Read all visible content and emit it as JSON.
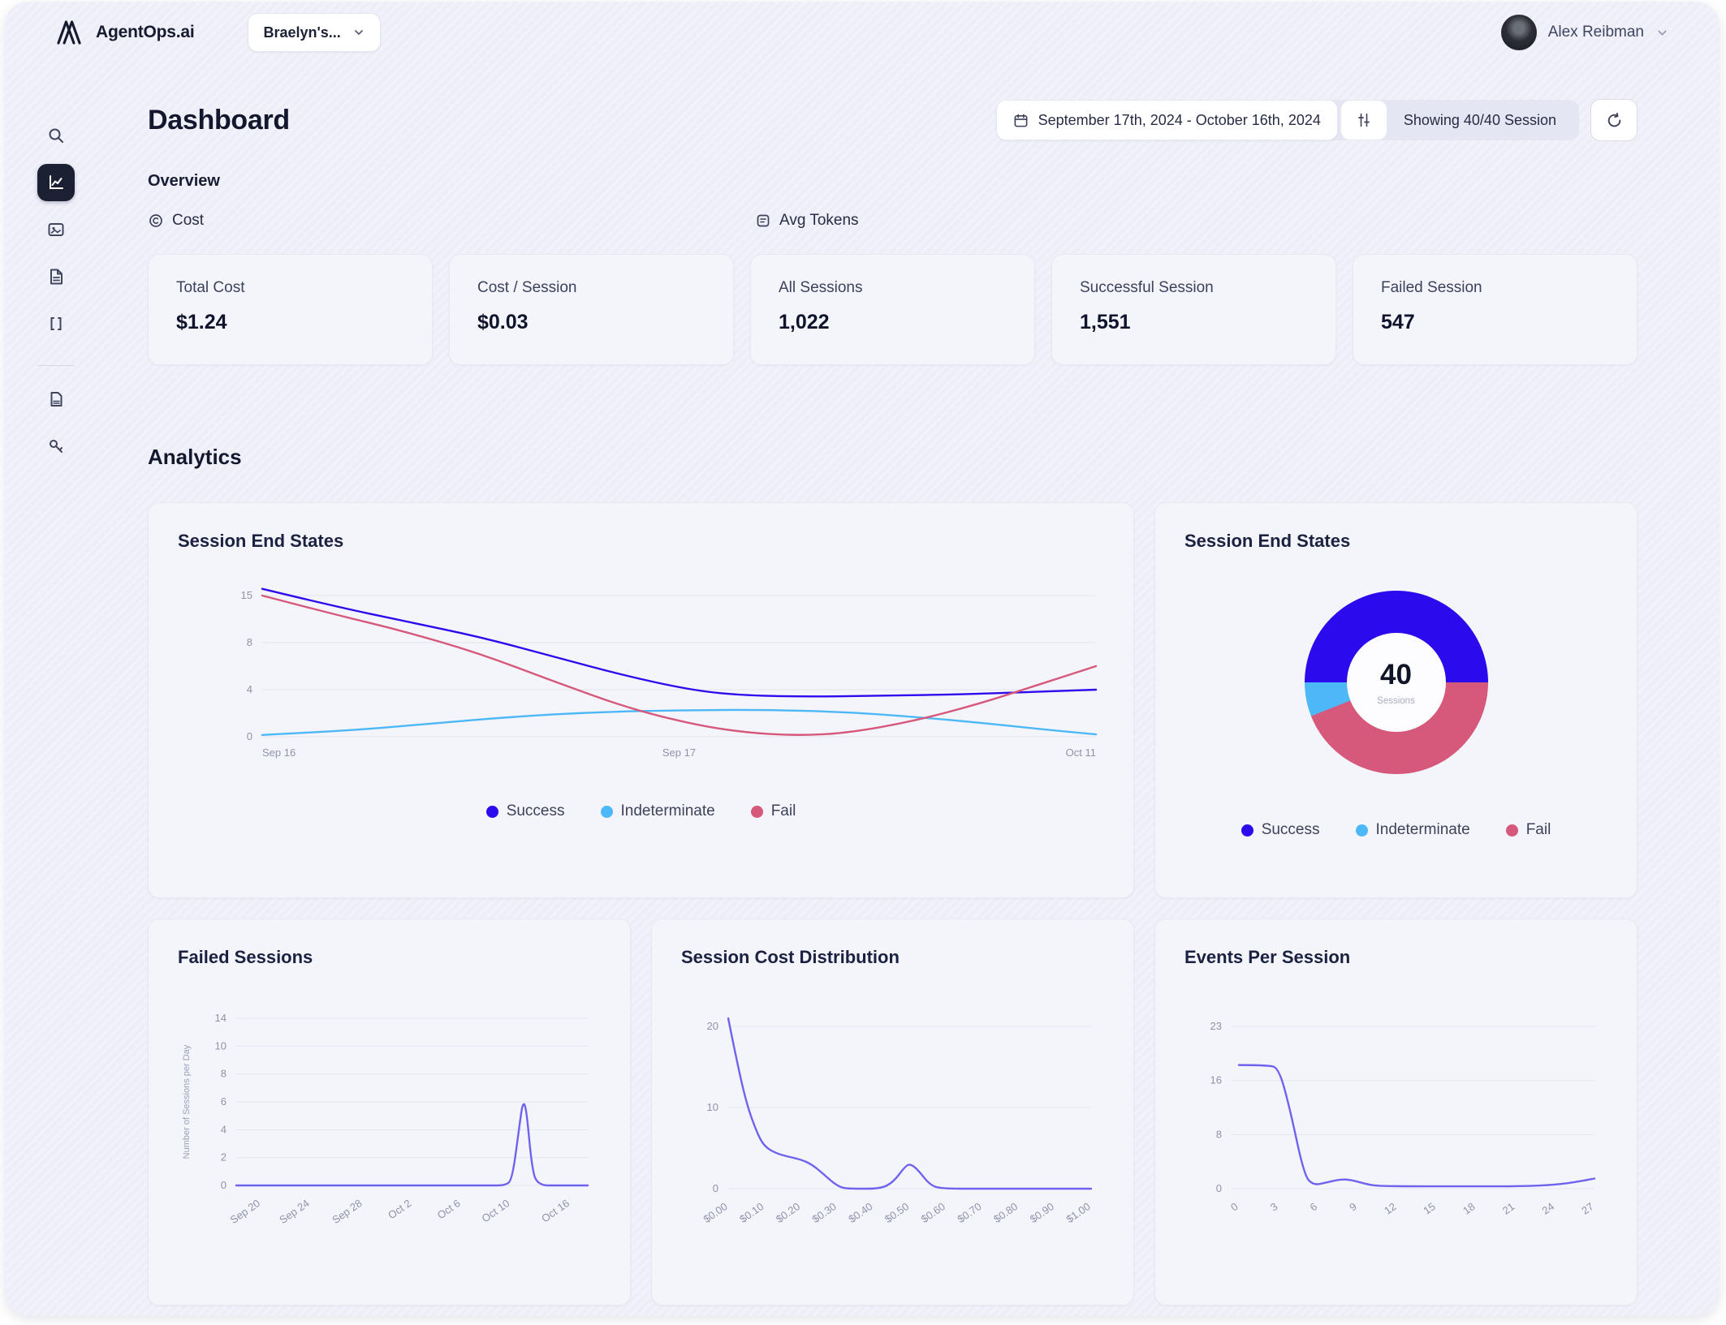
{
  "topbar": {
    "brand": "AgentOps.ai",
    "project_selector": "Braelyn's...",
    "user_name": "Alex Reibman"
  },
  "sidebar": {
    "icons": [
      "search",
      "analytics",
      "sessions",
      "projects",
      "traces",
      "docs",
      "api-keys"
    ],
    "active": "analytics"
  },
  "page": {
    "title": "Dashboard",
    "overview_label": "Overview",
    "analytics_label": "Analytics",
    "cost_group_label": "Cost",
    "tokens_group_label": "Avg Tokens"
  },
  "controls": {
    "date_range": "September 17th, 2024 - October 16th, 2024",
    "showing": "Showing 40/40 Session"
  },
  "overview": {
    "stats": [
      {
        "label": "Total Cost",
        "value": "$1.24"
      },
      {
        "label": "Cost / Session",
        "value": "$0.03"
      },
      {
        "label": "All Sessions",
        "value": "1,022"
      },
      {
        "label": "Successful Session",
        "value": "1,551"
      },
      {
        "label": "Failed Session",
        "value": "547"
      }
    ]
  },
  "colors": {
    "success": "#2b0aee",
    "indeterminate": "#4cb8f7",
    "fail": "#d6587a",
    "line_accent": "#6f63ee"
  },
  "chart_data": [
    {
      "type": "line",
      "title": "Session End States",
      "yticks": [
        15,
        8,
        4,
        0
      ],
      "xticks": {
        "labels": [
          "Sep 16",
          "Sep 17",
          "Oct 11"
        ],
        "positions": [
          0,
          0.5,
          1
        ],
        "rotate": false
      },
      "legend": [
        {
          "label": "Success",
          "color": "#2b0aee"
        },
        {
          "label": "Indeterminate",
          "color": "#4cb8f7"
        },
        {
          "label": "Fail",
          "color": "#d6587a"
        }
      ],
      "series": [
        {
          "name": "Success",
          "color": "#2b0aee",
          "points": [
            [
              0,
              16
            ],
            [
              0.08,
              13.6
            ],
            [
              0.17,
              11.2
            ],
            [
              0.26,
              8.9
            ],
            [
              0.35,
              6.8
            ],
            [
              0.44,
              5.1
            ],
            [
              0.52,
              3.9
            ],
            [
              0.58,
              3.5
            ],
            [
              0.66,
              3.4
            ],
            [
              0.75,
              3.5
            ],
            [
              0.84,
              3.6
            ],
            [
              0.92,
              3.8
            ],
            [
              1,
              4
            ]
          ]
        },
        {
          "name": "Indeterminate",
          "color": "#4cb8f7",
          "points": [
            [
              0,
              0.15
            ],
            [
              0.1,
              0.5
            ],
            [
              0.2,
              1.1
            ],
            [
              0.3,
              1.7
            ],
            [
              0.4,
              2.1
            ],
            [
              0.5,
              2.25
            ],
            [
              0.6,
              2.3
            ],
            [
              0.7,
              2.1
            ],
            [
              0.78,
              1.7
            ],
            [
              0.86,
              1.2
            ],
            [
              0.94,
              0.6
            ],
            [
              1,
              0.2
            ]
          ]
        },
        {
          "name": "Fail",
          "color": "#d6587a",
          "points": [
            [
              0,
              15
            ],
            [
              0.08,
              12.4
            ],
            [
              0.17,
              9.7
            ],
            [
              0.26,
              7.1
            ],
            [
              0.35,
              4.7
            ],
            [
              0.44,
              2.4
            ],
            [
              0.52,
              1
            ],
            [
              0.58,
              0.35
            ],
            [
              0.64,
              0.1
            ],
            [
              0.7,
              0.3
            ],
            [
              0.78,
              1.3
            ],
            [
              0.86,
              2.8
            ],
            [
              0.93,
              4.4
            ],
            [
              1,
              6
            ]
          ]
        }
      ]
    },
    {
      "type": "pie",
      "title": "Session End States",
      "center_value": "40",
      "center_label": "Sessions",
      "start_deg": 270,
      "slices": [
        {
          "label": "Success",
          "pct": 50,
          "color": "#2b0aee"
        },
        {
          "label": "Fail",
          "pct": 44,
          "color": "#d6587a"
        },
        {
          "label": "Indeterminate",
          "pct": 6,
          "color": "#4cb8f7"
        }
      ],
      "legend": [
        {
          "label": "Success",
          "color": "#2b0aee"
        },
        {
          "label": "Indeterminate",
          "color": "#4cb8f7"
        },
        {
          "label": "Fail",
          "color": "#d6587a"
        }
      ]
    },
    {
      "type": "line",
      "title": "Failed Sessions",
      "ylabel": "Number of Sessions per Day",
      "yticks": [
        14,
        10,
        8,
        6,
        4,
        2,
        0
      ],
      "xticks": {
        "labels": [
          "Sep 20",
          "Sep 24",
          "Sep 28",
          "Oct 2",
          "Oct 6",
          "Oct 10",
          "Oct 16"
        ],
        "positions": [
          0.07,
          0.21,
          0.36,
          0.5,
          0.64,
          0.78,
          0.95
        ],
        "rotate": true
      },
      "legend": [],
      "series": [
        {
          "name": "Failed Sessions",
          "color": "#6f63ee",
          "points": [
            [
              0,
              0
            ],
            [
              0.3,
              0
            ],
            [
              0.6,
              0
            ],
            [
              0.72,
              0
            ],
            [
              0.765,
              0
            ],
            [
              0.785,
              0.4
            ],
            [
              0.805,
              4.2
            ],
            [
              0.815,
              6
            ],
            [
              0.825,
              5.6
            ],
            [
              0.84,
              1.5
            ],
            [
              0.855,
              0
            ],
            [
              0.92,
              0
            ],
            [
              1,
              0
            ]
          ]
        }
      ]
    },
    {
      "type": "line",
      "title": "Session Cost Distribution",
      "yticks": [
        20,
        10,
        0
      ],
      "xticks": {
        "labels": [
          "$0.00",
          "$0.10",
          "$0.20",
          "$0.30",
          "$0.40",
          "$0.50",
          "$0.60",
          "$0.70",
          "$0.80",
          "$0.90",
          "$1.00"
        ],
        "positions": [
          0,
          0.1,
          0.2,
          0.3,
          0.4,
          0.5,
          0.6,
          0.7,
          0.8,
          0.9,
          1
        ],
        "rotate": true
      },
      "legend": [],
      "series": [
        {
          "name": "Sessions",
          "color": "#6f63ee",
          "points": [
            [
              0,
              21
            ],
            [
              0.02,
              16.5
            ],
            [
              0.05,
              10.5
            ],
            [
              0.08,
              6.8
            ],
            [
              0.1,
              5.2
            ],
            [
              0.13,
              4.4
            ],
            [
              0.16,
              4
            ],
            [
              0.2,
              3.6
            ],
            [
              0.23,
              3
            ],
            [
              0.26,
              1.9
            ],
            [
              0.29,
              0.7
            ],
            [
              0.315,
              0.05
            ],
            [
              0.35,
              0
            ],
            [
              0.42,
              0
            ],
            [
              0.455,
              0.8
            ],
            [
              0.49,
              2.9
            ],
            [
              0.505,
              3
            ],
            [
              0.525,
              2.2
            ],
            [
              0.555,
              0.5
            ],
            [
              0.585,
              0
            ],
            [
              0.7,
              0
            ],
            [
              0.85,
              0
            ],
            [
              1,
              0
            ]
          ]
        }
      ]
    },
    {
      "type": "line",
      "title": "Events Per Session",
      "yticks": [
        23,
        16,
        8,
        0
      ],
      "xticks": {
        "labels": [
          "0",
          "3",
          "6",
          "9",
          "12",
          "15",
          "18",
          "21",
          "24",
          "27"
        ],
        "positions": [
          0.02,
          0.129,
          0.238,
          0.347,
          0.456,
          0.564,
          0.673,
          0.782,
          0.891,
          1
        ],
        "rotate": true
      },
      "legend": [],
      "series": [
        {
          "name": "Events",
          "color": "#6f63ee",
          "points": [
            [
              0.02,
              18
            ],
            [
              0.1,
              18
            ],
            [
              0.13,
              17.6
            ],
            [
              0.16,
              12
            ],
            [
              0.2,
              2
            ],
            [
              0.225,
              0.5
            ],
            [
              0.26,
              0.9
            ],
            [
              0.3,
              1.4
            ],
            [
              0.33,
              1.3
            ],
            [
              0.37,
              0.7
            ],
            [
              0.4,
              0.4
            ],
            [
              0.5,
              0.35
            ],
            [
              0.65,
              0.35
            ],
            [
              0.8,
              0.35
            ],
            [
              0.9,
              0.6
            ],
            [
              0.96,
              1.1
            ],
            [
              1,
              1.5
            ]
          ]
        }
      ]
    }
  ]
}
